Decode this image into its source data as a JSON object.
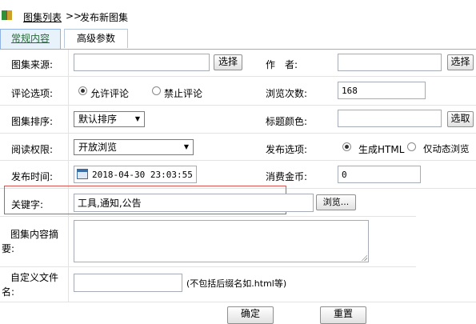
{
  "breadcrumb": {
    "link": "图集列表",
    "separator": ">>",
    "current": "发布新图集"
  },
  "tabs": [
    {
      "label": "常规内容"
    },
    {
      "label": "高级参数"
    }
  ],
  "form": {
    "source_label": "图集来源:",
    "source_value": "",
    "source_button": "选择",
    "author_label": "作　者:",
    "author_value": "",
    "author_button": "选择",
    "comment_label": "评论选项:",
    "comment_allow": "允许评论",
    "comment_deny": "禁止评论",
    "views_label": "浏览次数:",
    "views_value": "168",
    "order_label": "图集排序:",
    "order_selected": "默认排序",
    "title_color_label": "标题颜色:",
    "title_color_value": "",
    "title_color_button": "选取",
    "read_label": "阅读权限:",
    "read_selected": "开放浏览",
    "publish_label": "发布选项:",
    "publish_html": "生成HTML",
    "publish_dynamic": "仅动态浏览",
    "time_label": "发布时间:",
    "time_value": "2018-04-30 23:03:55",
    "coin_label": "消费金币:",
    "coin_value": "0",
    "keyword_label": "关键字:",
    "keyword_value": "工具,通知,公告",
    "keyword_button": "浏览...",
    "summary_label": "图集内容摘要:",
    "summary_value": "",
    "filename_label": "自定义文件名:",
    "filename_value": "",
    "filename_hint": "(不包括后缀名如.html等)"
  },
  "actions": {
    "confirm": "确定",
    "reset": "重置"
  },
  "colors": {
    "highlight_box": "#d9534f",
    "tab_active_bg": "#e7f2fb",
    "tab_border": "#8db2e3"
  }
}
